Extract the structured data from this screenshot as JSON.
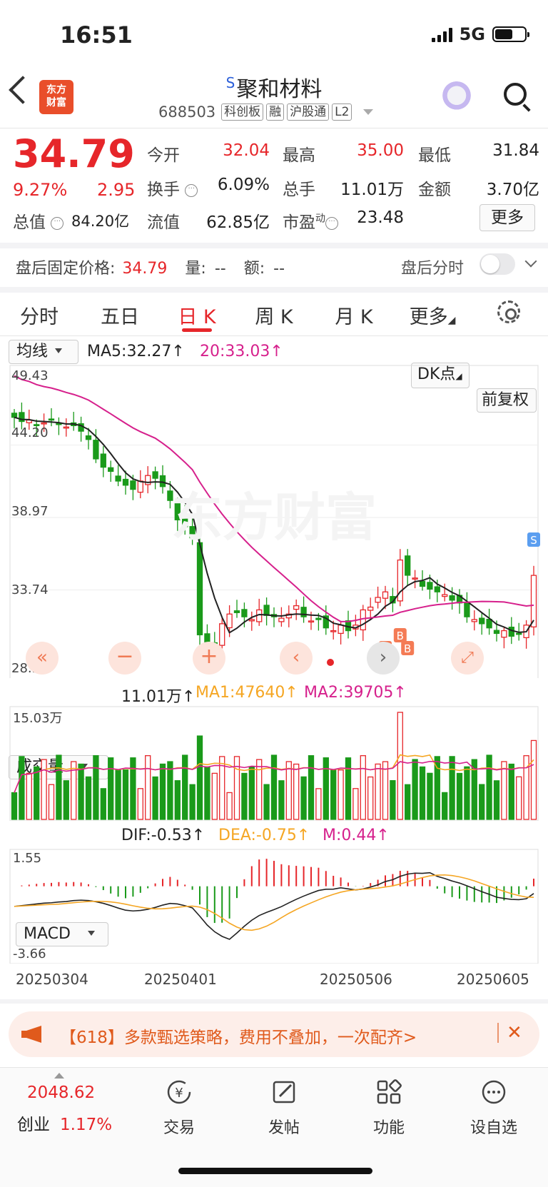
{
  "status_bar": {
    "time": "16:51",
    "network": "5G"
  },
  "header": {
    "stock_prefix": "S",
    "stock_name": "聚和材料",
    "stock_code": "688503",
    "tags": [
      "科创板",
      "融",
      "沪股通",
      "L2"
    ],
    "logo_text_line1": "东方",
    "logo_text_line2": "财富"
  },
  "quote": {
    "price": "34.79",
    "change_pct": "9.27%",
    "change": "2.95",
    "open_label": "今开",
    "open": "32.04",
    "high_label": "最高",
    "high": "35.00",
    "low_label": "最低",
    "low": "31.84",
    "turnover_label": "换手",
    "turnover": "6.09%",
    "volume_label": "总手",
    "volume": "11.01万",
    "amount_label": "金额",
    "amount": "3.70亿",
    "mcap_label": "总值",
    "mcap": "84.20亿",
    "float_label": "流值",
    "float": "62.85亿",
    "pe_label": "市盈",
    "pe_sup": "动",
    "pe": "23.48",
    "more_button": "更多"
  },
  "after_hours": {
    "price_label": "盘后固定价格:",
    "price": "34.79",
    "vol_label": "量:",
    "vol": "--",
    "amt_label": "额:",
    "amt": "--",
    "toggle_label": "盘后分时"
  },
  "tabs": [
    {
      "label": "分时"
    },
    {
      "label": "五日"
    },
    {
      "label": "日 K"
    },
    {
      "label": "周 K"
    },
    {
      "label": "月 K"
    },
    {
      "label": "更多"
    }
  ],
  "kline": {
    "ma_selector": "均线",
    "ma5": "MA5:32.27↑",
    "ma20": "20:33.03↑",
    "dk_button": "DK点",
    "adjust_button": "前复权",
    "y_labels": [
      "49.43",
      "44.20",
      "38.97",
      "33.74",
      "28.51"
    ],
    "watermark": "东方财富",
    "markers": {
      "buy": "B",
      "sell": "S"
    }
  },
  "volume": {
    "selector": "成交量",
    "value": "11.01万↑",
    "ma1": "MA1:47640↑",
    "ma2": "MA2:39705↑",
    "y_label": "15.03万"
  },
  "macd": {
    "selector": "MACD",
    "dif": "DIF:-0.53↑",
    "dea": "DEA:-0.75↑",
    "m": "M:0.44↑",
    "y_top": "1.55",
    "y_bottom": "-3.66"
  },
  "x_axis": [
    "20250304",
    "20250401",
    "20250506",
    "20250605"
  ],
  "chart_data": {
    "type": "candlestick",
    "closes": [
      46.2,
      45.9,
      46.0,
      45.6,
      45.8,
      46.0,
      45.7,
      45.5,
      45.6,
      45.2,
      44.6,
      43.2,
      42.6,
      42.3,
      41.6,
      41.3,
      41.0,
      41.6,
      42.0,
      41.8,
      41.2,
      40.2,
      38.8,
      38.3,
      37.5,
      30.5,
      29.6,
      29.9,
      31.3,
      32.0,
      32.1,
      31.8,
      31.6,
      32.3,
      31.9,
      31.8,
      31.7,
      32.0,
      32.6,
      31.8,
      31.5,
      31.6,
      31.0,
      30.8,
      31.2,
      30.8,
      31.2,
      32.3,
      32.5,
      33.2,
      33.6,
      32.8,
      35.9,
      34.8,
      34.6,
      34.0,
      33.8,
      33.6,
      33.4,
      33.0,
      32.8,
      31.8,
      31.6,
      31.3,
      31.0,
      30.6,
      30.8,
      30.4,
      30.6,
      31.2,
      34.79
    ],
    "colors": {
      "up": "#e6262a",
      "down": "#1a9a1a",
      "ma_black": "#222222",
      "ma_magenta": "#d6208c",
      "dea": "#f5a623"
    }
  }
}
